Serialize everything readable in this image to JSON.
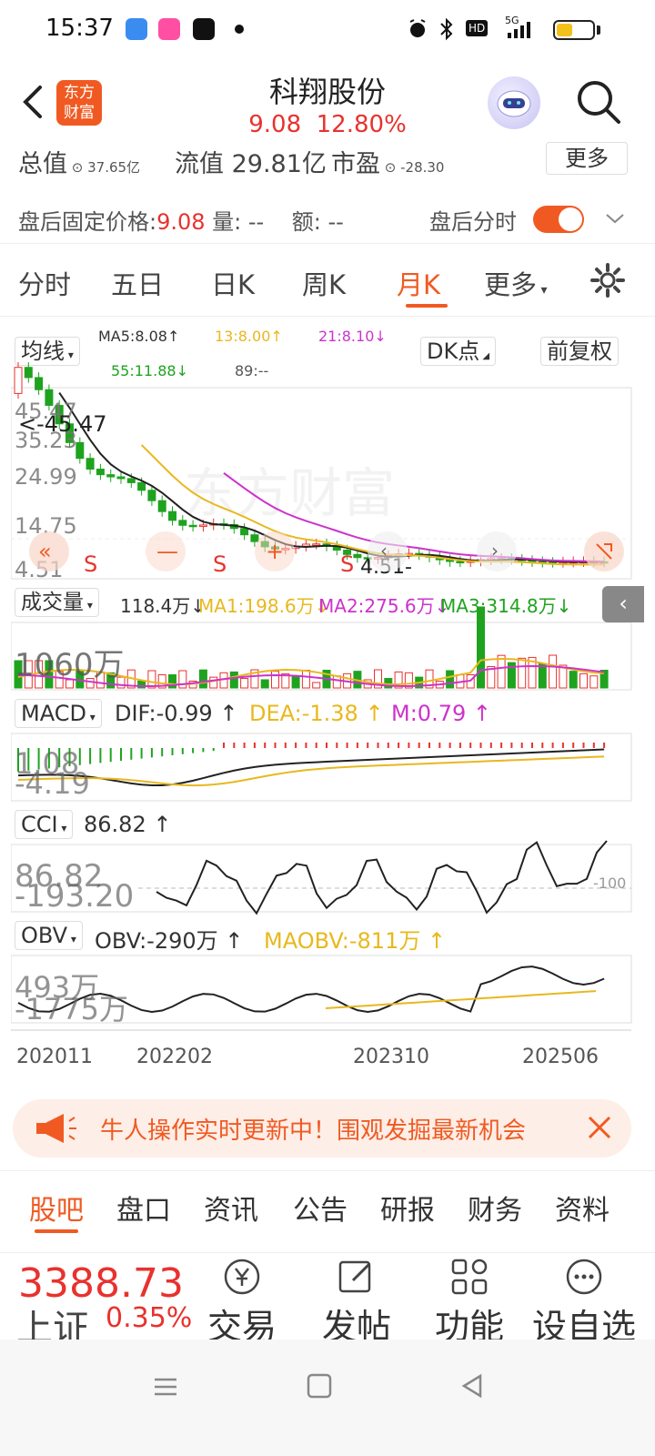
{
  "status_bar": {
    "time": "15:37",
    "battery_level": 0.45,
    "network": "5G",
    "hd_label": "HD"
  },
  "header": {
    "logo_line1": "东方",
    "logo_line2": "财富",
    "stock_name": "科翔股份",
    "price": "9.08",
    "change_pct": "12.80%"
  },
  "info": {
    "total_label": "总值",
    "total_value": "37.65亿",
    "float_label": "流值 29.81亿",
    "pe_label": "市盈",
    "pe_value": "-28.30",
    "more_label": "更多"
  },
  "after_hours": {
    "fixed_price_label": "盘后固定价格:",
    "fixed_price": "9.08",
    "volume_label": "量: --",
    "amount_label": "额: --",
    "toggle_label": "盘后分时",
    "toggle_on": true
  },
  "tabs": [
    {
      "label": "分时"
    },
    {
      "label": "五日"
    },
    {
      "label": "日K"
    },
    {
      "label": "周K"
    },
    {
      "label": "月K"
    },
    {
      "label": "更多"
    }
  ],
  "chart": {
    "ma_dropdown": "均线",
    "ma5": "MA5:8.08",
    "ma13": "13:8.00",
    "ma21": "21:8.10",
    "ma55": "55:11.88",
    "ma89": "89:--",
    "dk_label": "DK点",
    "adjust_label": "前复权",
    "watermark": "东方财富",
    "price_ticks": [
      "45.47",
      "35.23",
      "24.99",
      "14.75",
      "4.51"
    ],
    "high_marker": "<-45.47",
    "low_marker": "4.51-",
    "signal_s": "S",
    "vol_dropdown": "成交量",
    "vol_value": "118.4万",
    "vol_ma1": "MA1:198.6万",
    "vol_ma2": "MA2:275.6万",
    "vol_ma3": "MA3:314.8万",
    "vol_tick": "1060万",
    "macd_dropdown": "MACD",
    "dif": "DIF:-0.99",
    "dea": "DEA:-1.38",
    "m": "M:0.79",
    "macd_tick_hi": "1.08",
    "macd_tick_lo": "-4.19",
    "cci_dropdown": "CCI",
    "cci_value": "86.82",
    "cci_tick_hi": "86.82",
    "cci_tick_lo": "-193.20",
    "cci_ref": "-100",
    "obv_dropdown": "OBV",
    "obv_value": "OBV:-290万",
    "maobv_value": "MAOBV:-811万",
    "obv_tick_hi": "493万",
    "obv_tick_lo": "-1775万",
    "dates": [
      "202011",
      "202202",
      "202310",
      "202506"
    ]
  },
  "promo": {
    "text": "牛人操作实时更新中！围观发掘最新机会"
  },
  "subtabs": [
    {
      "label": "股吧"
    },
    {
      "label": "盘口"
    },
    {
      "label": "资讯"
    },
    {
      "label": "公告"
    },
    {
      "label": "研报"
    },
    {
      "label": "财务"
    },
    {
      "label": "资料"
    }
  ],
  "bottom": {
    "index_value": "3388.73",
    "index_name": "上证",
    "index_change": "0.35%",
    "nav": [
      {
        "label": "交易"
      },
      {
        "label": "发帖"
      },
      {
        "label": "功能"
      },
      {
        "label": "设自选"
      }
    ]
  },
  "colors": {
    "accent": "#f05a22",
    "up": "#e8322e",
    "down": "#1fa31f",
    "ma5": "#222222",
    "ma13": "#e8b81e",
    "ma21": "#cc33cc"
  }
}
